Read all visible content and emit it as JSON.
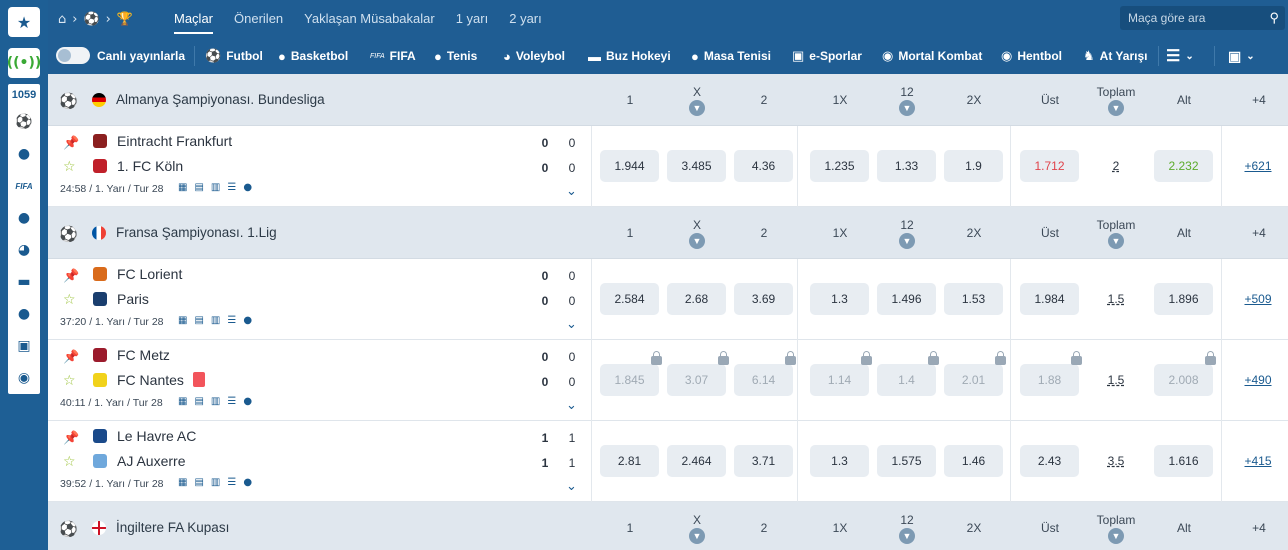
{
  "rail": {
    "live_count": "1059",
    "items": [
      "football-icon",
      "basketball-icon",
      "FIFA",
      "tennis-icon",
      "volleyball-icon",
      "hockey-icon",
      "table-tennis-icon",
      "esports-icon",
      "mortal-kombat-icon"
    ]
  },
  "topbar": {
    "tabs": [
      "Maçlar",
      "Önerilen",
      "Yaklaşan Müsabakalar",
      "1 yarı",
      "2 yarı"
    ],
    "active_tab": "Maçlar",
    "search_placeholder": "Maça göre ara"
  },
  "sportsbar": {
    "live_label": "Canlı yayınlarla",
    "sports": [
      "Futbol",
      "Basketbol",
      "FIFA",
      "Tenis",
      "Voleybol",
      "Buz Hokeyi",
      "Masa Tenisi",
      "e-Sporlar",
      "Mortal Kombat",
      "Hentbol",
      "At Yarışı"
    ]
  },
  "headers": {
    "c1": "1",
    "cx": "X",
    "c2": "2",
    "c1x": "1X",
    "c12": "12",
    "c2x": "2X",
    "ust": "Üst",
    "toplam": "Toplam",
    "alt": "Alt",
    "more": "+4"
  },
  "leagues": [
    {
      "name": "Almanya Şampiyonası. Bundesliga",
      "matches": [
        {
          "team1": "Eintracht Frankfurt",
          "team2": "1. FC Köln",
          "s1": "0",
          "s1b": "0",
          "s2": "0",
          "s2b": "0",
          "time": "24:58 / 1. Yarı / Tur 28",
          "odds": [
            "1.944",
            "3.485",
            "4.36",
            "1.235",
            "1.33",
            "1.9",
            "1.712"
          ],
          "total": "2",
          "alt": "2.232",
          "more": "+621"
        }
      ]
    },
    {
      "name": "Fransa Şampiyonası. 1.Lig",
      "matches": [
        {
          "team1": "FC Lorient",
          "team2": "Paris",
          "s1": "0",
          "s1b": "0",
          "s2": "0",
          "s2b": "0",
          "time": "37:20 / 1. Yarı / Tur 28",
          "odds": [
            "2.584",
            "2.68",
            "3.69",
            "1.3",
            "1.496",
            "1.53",
            "1.984"
          ],
          "total": "1.5",
          "alt": "1.896",
          "more": "+509"
        },
        {
          "team1": "FC Metz",
          "team2": "FC Nantes",
          "s1": "0",
          "s1b": "0",
          "s2": "0",
          "s2b": "0",
          "time": "40:11 / 1. Yarı / Tur 28",
          "odds": [
            "1.845",
            "3.07",
            "6.14",
            "1.14",
            "1.4",
            "2.01",
            "1.88"
          ],
          "total": "1.5",
          "alt": "2.008",
          "more": "+490"
        },
        {
          "team1": "Le Havre AC",
          "team2": "AJ Auxerre",
          "s1": "1",
          "s1b": "1",
          "s2": "1",
          "s2b": "1",
          "time": "39:52 / 1. Yarı / Tur 28",
          "odds": [
            "2.81",
            "2.464",
            "3.71",
            "1.3",
            "1.575",
            "1.46",
            "2.43"
          ],
          "total": "3.5",
          "alt": "1.616",
          "more": "+415"
        }
      ]
    },
    {
      "name": "İngiltere FA Kupası",
      "matches": []
    }
  ]
}
